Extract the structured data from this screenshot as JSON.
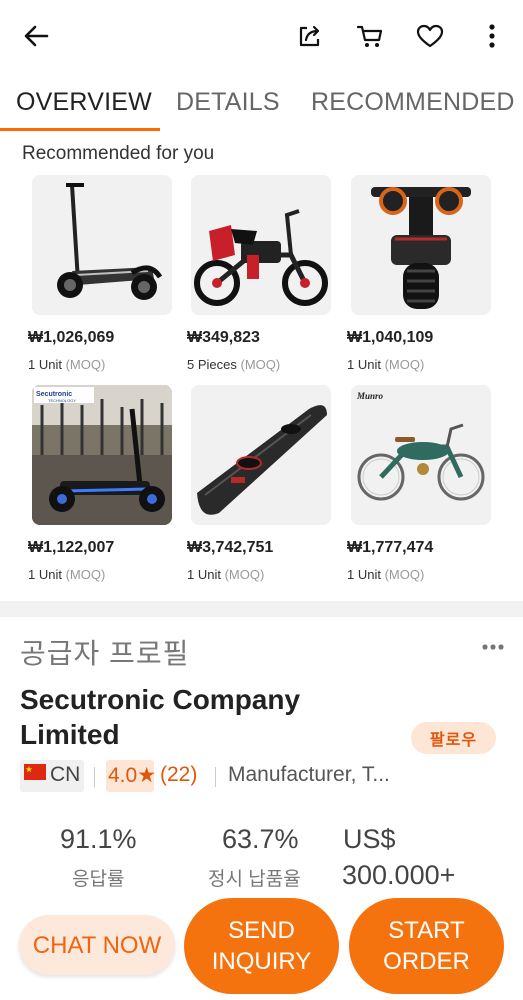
{
  "header": {
    "icons": [
      "back-arrow-icon",
      "share-icon",
      "cart-icon",
      "heart-icon",
      "more-vertical-icon"
    ]
  },
  "tabs": [
    {
      "label": "OVERVIEW",
      "active": true
    },
    {
      "label": "DETAILS",
      "active": false
    },
    {
      "label": "RECOMMENDED",
      "active": false
    }
  ],
  "recommended": {
    "title": "Recommended for you",
    "moq_suffix": "(MOQ)",
    "items": [
      {
        "price": "₩1,026,069",
        "unit": "1 Unit",
        "image": "electric-scooter"
      },
      {
        "price": "₩349,823",
        "unit": "5 Pieces",
        "image": "electric-bike-red"
      },
      {
        "price": "₩1,040,109",
        "unit": "1 Unit",
        "image": "offroad-scooter"
      },
      {
        "price": "₩1,122,007",
        "unit": "1 Unit",
        "image": "secutronic-scooter-showroom"
      },
      {
        "price": "₩3,742,751",
        "unit": "1 Unit",
        "image": "electric-surfboard"
      },
      {
        "price": "₩1,777,474",
        "unit": "1 Unit",
        "image": "vintage-ebike-green"
      }
    ],
    "thumb_labels": {
      "secutronic": "Secutronic",
      "technology": "TECHNOLOGY",
      "munro": "Munro"
    }
  },
  "supplier": {
    "heading": "공급자 프로필",
    "name": "Secutronic Company Limited",
    "badge": "팔로우",
    "country_code": "CN",
    "rating": "4.0★",
    "review_count": "(22)",
    "business_type": "Manufacturer, T...",
    "stats": [
      {
        "value": "91.1%",
        "label": "응답률"
      },
      {
        "value": "63.7%",
        "label": "정시 납품율"
      },
      {
        "value": "US$ 300.000+",
        "value_line1": "US$",
        "value_line2": "300.000+",
        "label": ""
      }
    ]
  },
  "actions": {
    "chat": "CHAT NOW",
    "inquiry_line1": "SEND",
    "inquiry_line2": "INQUIRY",
    "order_line1": "START",
    "order_line2": "ORDER"
  },
  "colors": {
    "accent": "#f5730f",
    "accent_light": "#fde8dc",
    "tab_underline": "#ff6a00"
  }
}
